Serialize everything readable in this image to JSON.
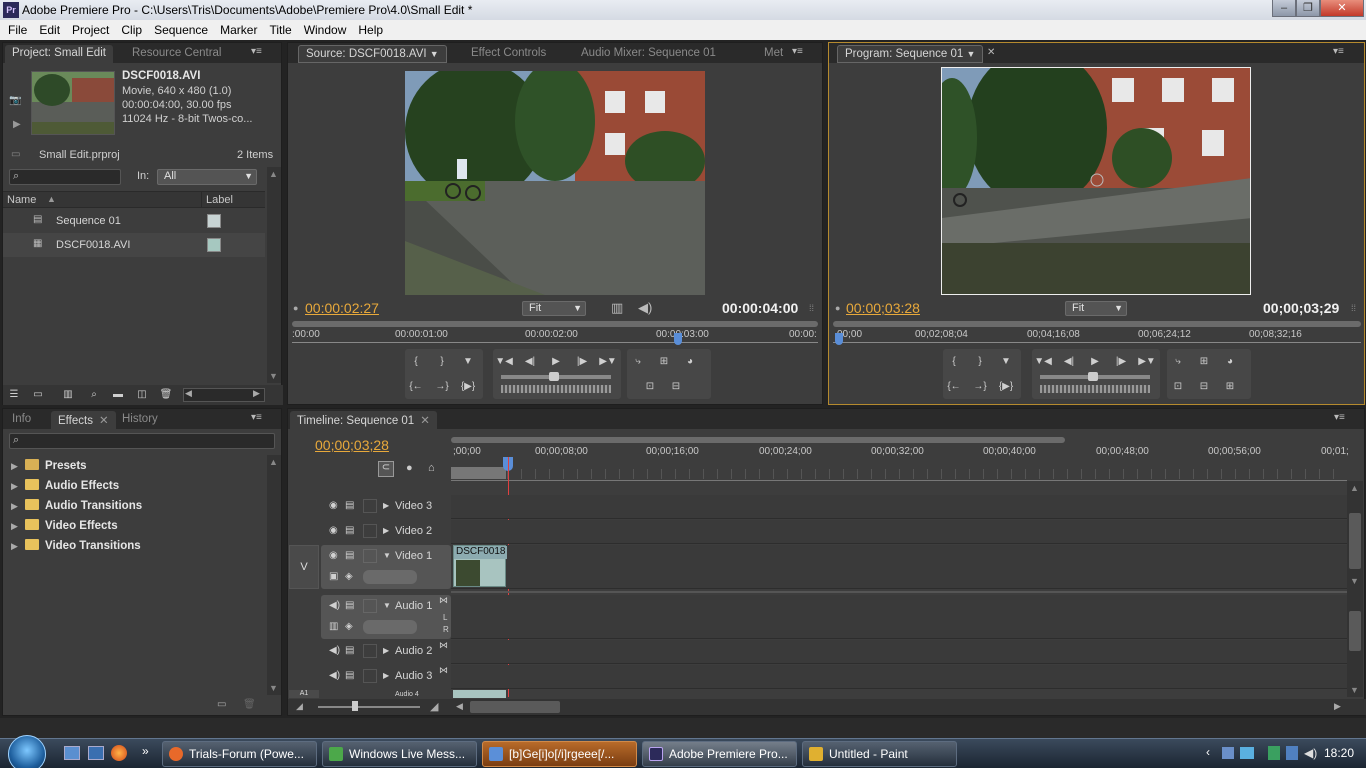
{
  "window": {
    "title": "Adobe Premiere Pro - C:\\Users\\Tris\\Documents\\Adobe\\Premiere Pro\\4.0\\Small Edit *",
    "app_icon": "Pr",
    "min": "‒",
    "max": "❐",
    "close": "✕"
  },
  "menubar": [
    "File",
    "Edit",
    "Project",
    "Clip",
    "Sequence",
    "Marker",
    "Title",
    "Window",
    "Help"
  ],
  "project_panel": {
    "tabs": [
      "Project: Small Edit",
      "Resource Central"
    ],
    "clip_name": "DSCF0018.AVI",
    "clip_info": [
      "Movie, 640 x 480 (1.0)",
      "00:00:04:00, 30.00 fps",
      "11024 Hz - 8-bit Twos-co..."
    ],
    "project_file": "Small Edit.prproj",
    "item_count": "2 Items",
    "in_label": "In:",
    "in_value": "All",
    "columns": [
      "Name",
      "Label"
    ],
    "items": [
      {
        "name": "Sequence 01",
        "label_color": "#c7d3d3"
      },
      {
        "name": "DSCF0018.AVI",
        "label_color": "#a6c8c0"
      }
    ]
  },
  "source_monitor": {
    "tabs": [
      "Source: DSCF0018.AVI",
      "Effect Controls",
      "Audio Mixer: Sequence 01",
      "Met"
    ],
    "current_time": "00:00:02:27",
    "duration": "00:00:04:00",
    "fit": "Fit",
    "ruler": [
      ":00:00",
      "00:00:01:00",
      "00:00:02:00",
      "00:00:03:00",
      "00:00:"
    ]
  },
  "program_monitor": {
    "tabs": [
      "Program: Sequence 01"
    ],
    "current_time": "00:00;03:28",
    "duration": "00;00;03;29",
    "fit": "Fit",
    "ruler": [
      "00;00",
      "00;02;08;04",
      "00;04;16;08",
      "00;06;24;12",
      "00;08;32;16"
    ]
  },
  "effects_panel": {
    "tabs": [
      "Info",
      "Effects",
      "History"
    ],
    "tree": [
      "Presets",
      "Audio Effects",
      "Audio Transitions",
      "Video Effects",
      "Video Transitions"
    ]
  },
  "timeline": {
    "tab": "Timeline: Sequence 01",
    "current_time": "00;00;03;28",
    "ruler": [
      ";00;00",
      "00;00;08;00",
      "00;00;16;00",
      "00;00;24;00",
      "00;00;32;00",
      "00;00;40;00",
      "00;00;48;00",
      "00;00;56;00",
      "00;01;"
    ],
    "video_tracks": [
      "Video 3",
      "Video 2",
      "Video 1"
    ],
    "audio_tracks": [
      "Audio 1",
      "Audio 2",
      "Audio 3",
      "Audio 4"
    ],
    "v_label": "V",
    "a_label": "A1",
    "clip_label": "DSCF0018"
  },
  "taskbar": {
    "windows": [
      {
        "label": "Trials-Forum (Powe...",
        "icon_color": "#e8692a"
      },
      {
        "label": "Windows Live Mess...",
        "icon_color": "#4ca84a"
      },
      {
        "label": "[b]Ge[i]o[/i]rgeee[/...",
        "icon_color": "#5b8fd8"
      },
      {
        "label": "Adobe Premiere Pro...",
        "icon_color": "#2c2a5a"
      },
      {
        "label": "Untitled - Paint",
        "icon_color": "#e0b030"
      }
    ],
    "clock": "18:20"
  }
}
